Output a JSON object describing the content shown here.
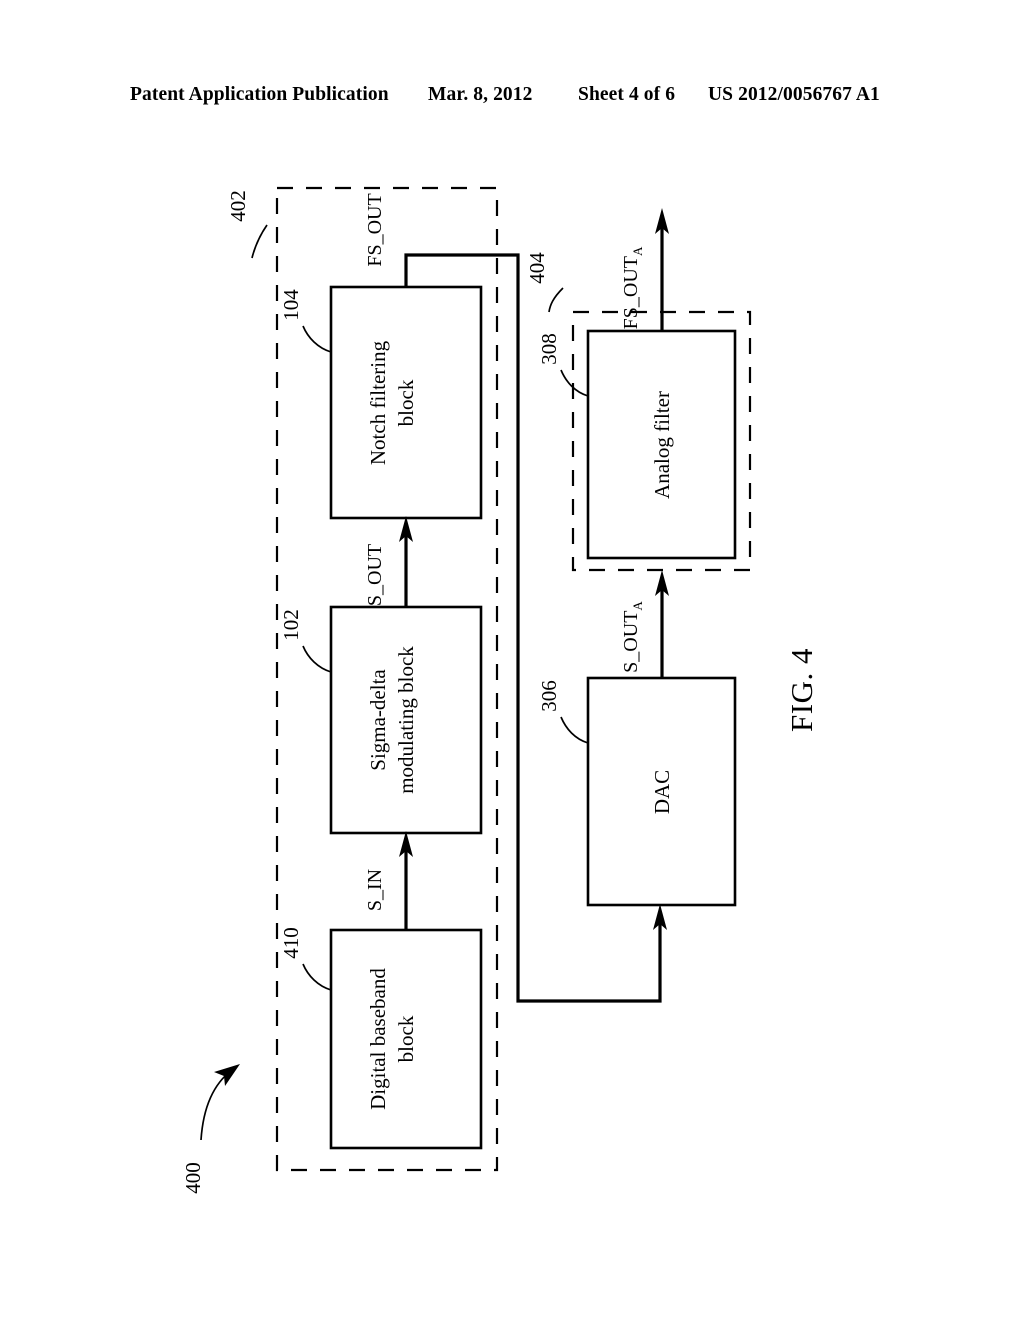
{
  "header": {
    "publication": "Patent Application Publication",
    "date": "Mar. 8, 2012",
    "sheet": "Sheet 4 of 6",
    "patent_number": "US 2012/0056767 A1"
  },
  "figure": {
    "caption": "FIG. 4",
    "system_ref": "400",
    "blocks": [
      {
        "id": "digital-baseband",
        "label_line1": "Digital baseband",
        "label_line2": "block",
        "ref": "410"
      },
      {
        "id": "sigma-delta",
        "label_line1": "Sigma-delta",
        "label_line2": "modulating block",
        "ref": "102"
      },
      {
        "id": "notch-filtering",
        "label_line1": "Notch filtering",
        "label_line2": "block",
        "ref": "104"
      },
      {
        "id": "dac",
        "label_line1": "DAC",
        "label_line2": "",
        "ref": "306"
      },
      {
        "id": "analog-filter",
        "label_line1": "Analog filter",
        "label_line2": "",
        "ref": "308"
      }
    ],
    "enclosures": [
      {
        "id": "digital-section",
        "ref": "402"
      },
      {
        "id": "analog-section",
        "ref": "404"
      }
    ],
    "signals": [
      {
        "id": "s-in",
        "label": "S_IN",
        "subscript": ""
      },
      {
        "id": "s-out",
        "label": "S_OUT",
        "subscript": ""
      },
      {
        "id": "fs-out",
        "label": "FS_OUT",
        "subscript": ""
      },
      {
        "id": "s-out-a",
        "label": "S_OUT",
        "subscript": "A"
      },
      {
        "id": "fs-out-a",
        "label": "FS_OUT",
        "subscript": "A"
      }
    ]
  }
}
